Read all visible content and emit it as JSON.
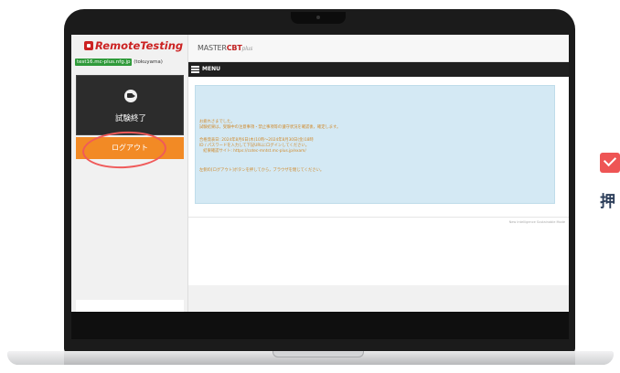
{
  "app": {
    "logo_text": "RemoteTesting",
    "brand_prefix": "MASTER",
    "brand_cbt": "CBT",
    "brand_suffix": "plus",
    "colors": {
      "accent": "#f28a25",
      "logo": "#cc2222",
      "notice_bg": "#d4e9f4",
      "notice_text": "#d08a2c",
      "highlight_ring": "#f05a5a"
    }
  },
  "sidebar": {
    "user_id": "test16.mc-plus.nfg.jp",
    "user_name": "(tokuyama)",
    "exam_end_icon": "video-camera-icon",
    "exam_end_label": "試験終了",
    "logout_label": "ログアウト"
  },
  "menubar": {
    "label": "MENU",
    "icon": "hamburger-icon"
  },
  "notice": {
    "lines": [
      "お疲れさまでした。",
      "試験結果は，受験中の注意事項・禁止事項等の遵守状況を確認後，確定します。",
      "",
      "合格発表日: 2024年8月6日(木)10時〜2024年8月30日(金)18時",
      "ID / パスワードを入力して下記URLにログインしてください。",
      "　結果確認サイト: https://cotec-mntst.mc-plus.jp/exam/",
      "",
      "左側の[ログアウト]ボタンを押してから，ブラウザを閉じてください。"
    ]
  },
  "footer": {
    "text": "New Intelligence Sustainable Mode"
  },
  "decor": {
    "check_icon": "checkbox-check-icon",
    "side_char": "押"
  }
}
